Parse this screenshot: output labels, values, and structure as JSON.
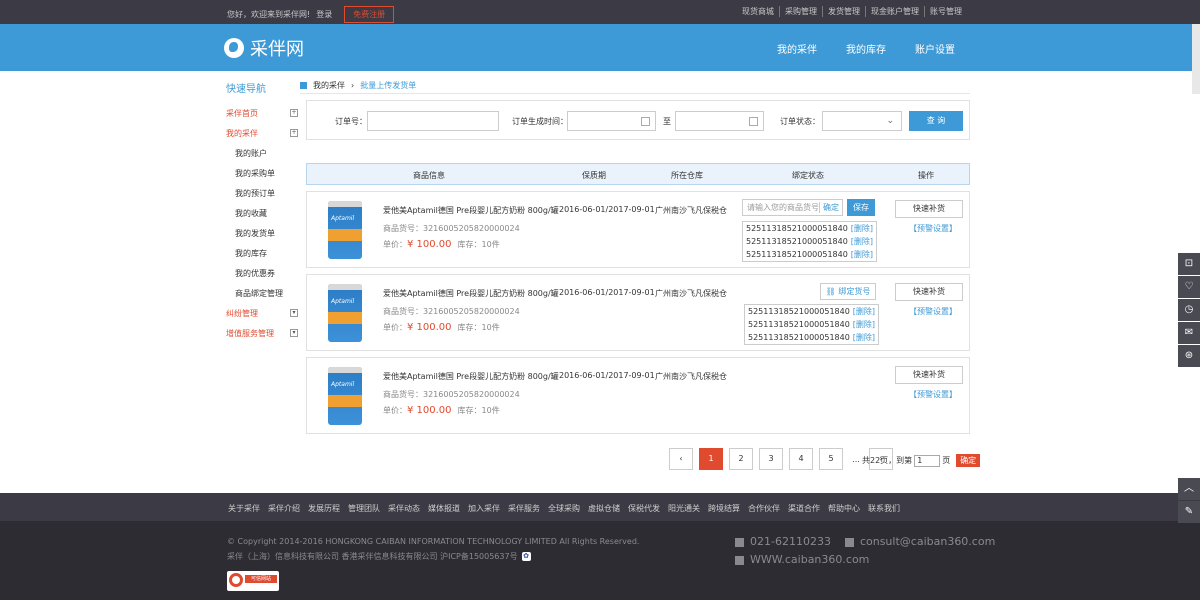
{
  "topbar": {
    "welcome": "您好，欢迎来到采伴网!",
    "login": "登录",
    "register": "免费注册",
    "links": [
      "现货商城",
      "采购管理",
      "发货管理",
      "现金账户管理",
      "账号管理"
    ]
  },
  "header": {
    "logo_text": "采伴网",
    "nav": [
      "我的采伴",
      "我的库存",
      "账户设置"
    ]
  },
  "sidebar": {
    "title": "快速导航",
    "items": [
      {
        "label": "采伴首页",
        "type": "red",
        "toggle": "+"
      },
      {
        "label": "我的采伴",
        "type": "red",
        "toggle": "+"
      },
      {
        "label": "我的账户",
        "type": "sub"
      },
      {
        "label": "我的采购单",
        "type": "sub"
      },
      {
        "label": "我的预订单",
        "type": "sub"
      },
      {
        "label": "我的收藏",
        "type": "sub"
      },
      {
        "label": "我的发货单",
        "type": "sub"
      },
      {
        "label": "我的库存",
        "type": "sub"
      },
      {
        "label": "我的优惠券",
        "type": "sub"
      },
      {
        "label": "商品绑定管理",
        "type": "sub"
      },
      {
        "label": "纠纷管理",
        "type": "red",
        "toggle": "▾"
      },
      {
        "label": "增值服务管理",
        "type": "red",
        "toggle": "▾"
      }
    ]
  },
  "breadcrumb": {
    "home": "我的采伴",
    "current": "批量上传发货单"
  },
  "filter": {
    "order_no_label": "订单号：",
    "order_time_label": "订单生成时间：",
    "to_label": "至",
    "status_label": "订单状态：",
    "search_button": "查 询"
  },
  "table": {
    "headers": [
      "商品信息",
      "保质期",
      "所在仓库",
      "绑定状态",
      "操作"
    ]
  },
  "products": [
    {
      "name": "爱他美Aptamil德国 Pre段婴儿配方奶粉 800g/罐",
      "code": "商品货号：3216005205820000024",
      "price_label": "单价：",
      "price": "¥ 100.00",
      "stock": "库存：10件",
      "shelf_life": "2016-06-01/2017-09-01",
      "warehouse": "广州南沙飞凡保税仓",
      "bind_placeholder": "请输入您的商品货号",
      "bind_confirm": "确定",
      "save": "保存",
      "serials": [
        "525113185210000518​40",
        "5251131852100005184​0",
        "5251131852100005184​0"
      ],
      "delete_label": "[删除]",
      "restock": "快速补货",
      "alarm": "【预警设置】"
    },
    {
      "name": "爱他美Aptamil德国 Pre段婴儿配方奶粉 800g/罐",
      "code": "商品货号：3216005205820000024",
      "price_label": "单价：",
      "price": "¥ 100.00",
      "stock": "库存：10件",
      "shelf_life": "2016-06-01/2017-09-01",
      "warehouse": "广州南沙飞凡保税仓",
      "bind_button": "绑定货号",
      "serials": [
        "5251131852100005184​0",
        "5251131852100005184​0",
        "5251131852100005184​0"
      ],
      "delete_label": "[删除]",
      "restock": "快速补货",
      "alarm": "【预警设置】"
    },
    {
      "name": "爱他美Aptamil德国 Pre段婴儿配方奶粉 800g/罐",
      "code": "商品货号：3216005205820000024",
      "price_label": "单价：",
      "price": "¥ 100.00",
      "stock": "库存：10件",
      "shelf_life": "2016-06-01/2017-09-01",
      "warehouse": "广州南沙飞凡保税仓",
      "restock": "快速补货",
      "alarm": "【预警设置】"
    }
  ],
  "product_brand": "Aptamil",
  "pagination": {
    "prev": "‹",
    "pages": [
      "1",
      "2",
      "3",
      "4",
      "5"
    ],
    "ellipsis": "...",
    "next": "›",
    "total_text": "共22页，到第",
    "page_value": "1",
    "page_suffix": "页",
    "go": "确定"
  },
  "footer": {
    "links": [
      "关于采伴",
      "采伴介绍",
      "发展历程",
      "管理团队",
      "采伴动态",
      "媒体报道",
      "加入采伴",
      "采伴服务",
      "全球采购",
      "虚拟仓储",
      "保税代发",
      "阳光通关",
      "跨境结算",
      "合作伙伴",
      "渠道合作",
      "帮助中心",
      "联系我们"
    ],
    "copyright": "© Copyright 2014-2016 HONGKONG CAIBAN INFORMATION TECHNOLOGY LIMITED All Rights Reserved.",
    "icp": "采伴（上海）信息科技有限公司 香港采伴信息科技有限公司 沪ICP备15005637号",
    "trust_badge": "可信网站",
    "phone_icon": "T",
    "phone": "021-62110233",
    "email_icon": "E",
    "email": "consult@caiban360.com",
    "web_icon": "W",
    "website": "WWW.caiban360.com"
  },
  "colors": {
    "accent": "#3e9ad6",
    "red": "#e04a2f",
    "dark": "#3c3b45"
  }
}
